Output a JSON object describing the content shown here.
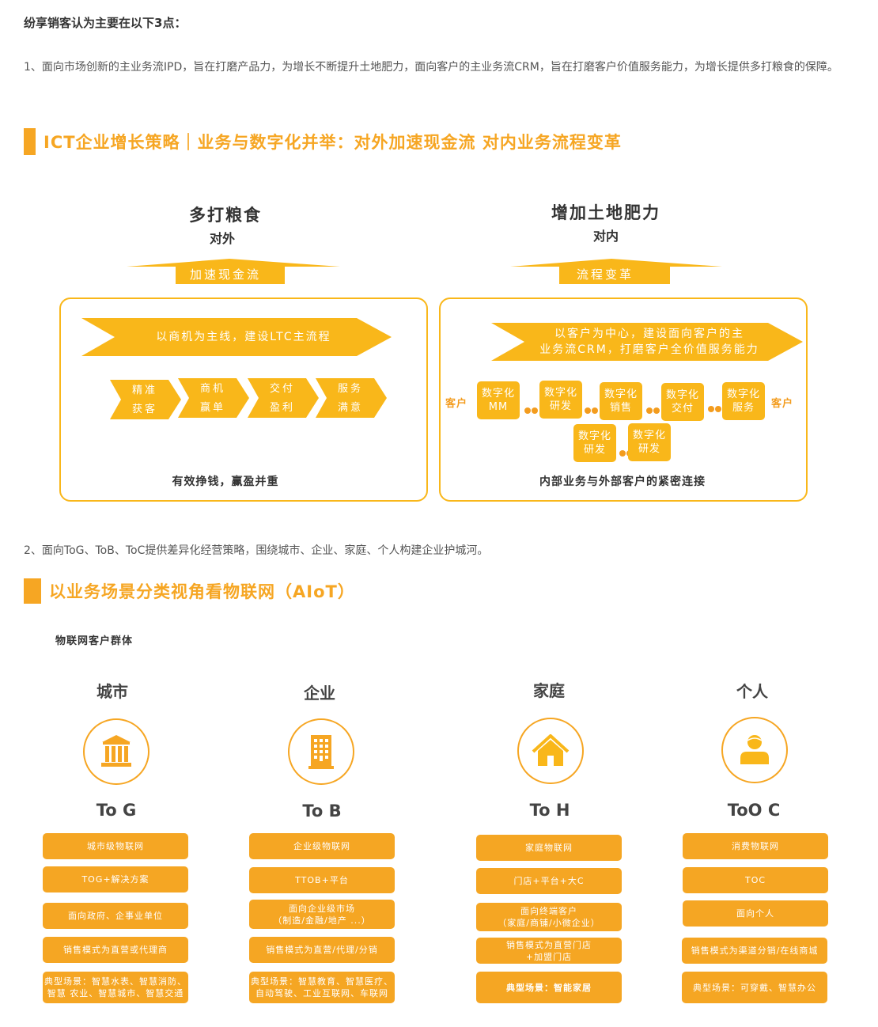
{
  "intro": "纷享销客认为主要在以下3点：",
  "point1": "1、面向市场创新的主业务流IPD，旨在打磨产品力，为增长不断提升土地肥力，面向客户的主业务流CRM，旨在打磨客户价值服务能力，为增长提供多打粮食的保障。",
  "section1": {
    "title": "ICT企业增长策略｜业务与数字化并举：对外加速现金流 对内业务流程变革",
    "left": {
      "heading": "多打粮食",
      "subheading": "对外",
      "arrow_label": "加速现金流",
      "chevron_label": "以商机为主线，建设LTC主流程",
      "steps": [
        {
          "line1": "精准",
          "line2": "获客"
        },
        {
          "line1": "商机",
          "line2": "赢单"
        },
        {
          "line1": "交付",
          "line2": "盈利"
        },
        {
          "line1": "服务",
          "line2": "满意"
        }
      ],
      "caption": "有效挣钱，赢盈并重"
    },
    "right": {
      "heading": "增加土地肥力",
      "subheading": "对内",
      "arrow_label": "流程变革",
      "chevron_line1": "以客户为中心，建设面向客户的主",
      "chevron_line2": "业务流CRM，打磨客户全价值服务能力",
      "customer_label": "客户",
      "boxes_row1": [
        {
          "line1": "数字化",
          "line2": "MM"
        },
        {
          "line1": "数字化",
          "line2": "研发"
        },
        {
          "line1": "数字化",
          "line2": "销售"
        },
        {
          "line1": "数字化",
          "line2": "交付"
        },
        {
          "line1": "数字化",
          "line2": "服务"
        }
      ],
      "boxes_row2": [
        {
          "line1": "数字化",
          "line2": "研发"
        },
        {
          "line1": "数字化",
          "line2": "研发"
        }
      ],
      "caption": "内部业务与外部客户的紧密连接"
    }
  },
  "point2": "2、面向ToG、ToB、ToC提供差异化经营策略，围绕城市、企业、家庭、个人构建企业护城河。",
  "section2": {
    "title": "以业务场景分类视角看物联网（AIoT）",
    "subtitle": "物联网客户群体",
    "groups": [
      {
        "title": "城市",
        "icon": "government-building-icon",
        "code": "To G",
        "items": [
          {
            "lines": [
              "城市级物联网"
            ]
          },
          {
            "lines": [
              "TOG+解决方案"
            ]
          },
          {
            "lines": [
              "面向政府、企事业单位"
            ]
          },
          {
            "lines": [
              "销售模式为直营或代理商"
            ]
          },
          {
            "lines": [
              "典型场景：智慧水表、智慧消防、",
              "智慧 农业、智慧城市、智慧交通"
            ]
          }
        ]
      },
      {
        "title": "企业",
        "icon": "office-building-icon",
        "code": "To B",
        "items": [
          {
            "lines": [
              "企业级物联网"
            ]
          },
          {
            "lines": [
              "TTOB+平台"
            ]
          },
          {
            "lines": [
              "面向企业级市场",
              "（制造/金融/地产 ...）"
            ]
          },
          {
            "lines": [
              "销售模式为直营/代理/分销"
            ]
          },
          {
            "lines": [
              "典型场景：智慧教育、智慧医疗、",
              "自动驾驶、工业互联网、车联网"
            ]
          }
        ]
      },
      {
        "title": "家庭",
        "icon": "home-icon",
        "code": "To H",
        "items": [
          {
            "lines": [
              "家庭物联网"
            ]
          },
          {
            "lines": [
              "门店+平台+大C"
            ]
          },
          {
            "lines": [
              "面向终端客户",
              "（家庭/商铺/小微企业）"
            ]
          },
          {
            "lines": [
              "销售模式为直营门店",
              "+加盟门店"
            ]
          },
          {
            "lines": [
              "典型场景：智能家居"
            ],
            "bold": true
          }
        ]
      },
      {
        "title": "个人",
        "icon": "person-icon",
        "code": "ToO C",
        "items": [
          {
            "lines": [
              "消费物联网"
            ]
          },
          {
            "lines": [
              "TOC"
            ]
          },
          {
            "lines": [
              "面向个人"
            ]
          },
          {
            "lines": [
              "销售模式为渠道分销/在线商城"
            ]
          },
          {
            "lines": [
              "典型场景：可穿戴、智慧办公"
            ]
          }
        ]
      }
    ]
  },
  "colors": {
    "accent": "#f6a623",
    "diagram_fill": "#f9b71a",
    "box_fill": "#f5a623",
    "dot": "#f39c1e",
    "text_dark": "#333333"
  }
}
